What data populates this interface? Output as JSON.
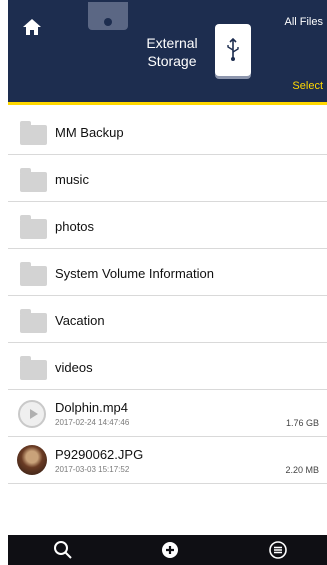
{
  "header": {
    "title_line1": "External",
    "title_line2": "Storage",
    "all_files_label": "All Files",
    "select_label": "Select"
  },
  "items": [
    {
      "type": "folder",
      "name": "MM Backup"
    },
    {
      "type": "folder",
      "name": "music"
    },
    {
      "type": "folder",
      "name": "photos"
    },
    {
      "type": "folder",
      "name": "System Volume Information"
    },
    {
      "type": "folder",
      "name": "Vacation"
    },
    {
      "type": "folder",
      "name": "videos"
    },
    {
      "type": "video",
      "name": "Dolphin.mp4",
      "date": "2017-02-24 14:47:46",
      "size": "1.76 GB"
    },
    {
      "type": "image",
      "name": "P9290062.JPG",
      "date": "2017-03-03 15:17:52",
      "size": "2.20 MB"
    }
  ],
  "icons": {
    "home": "home-icon",
    "usb": "usb-icon",
    "search": "search-icon",
    "add": "add-icon",
    "menu": "menu-icon"
  },
  "colors": {
    "header_bg": "#1d2d4f",
    "accent": "#ffd800"
  }
}
